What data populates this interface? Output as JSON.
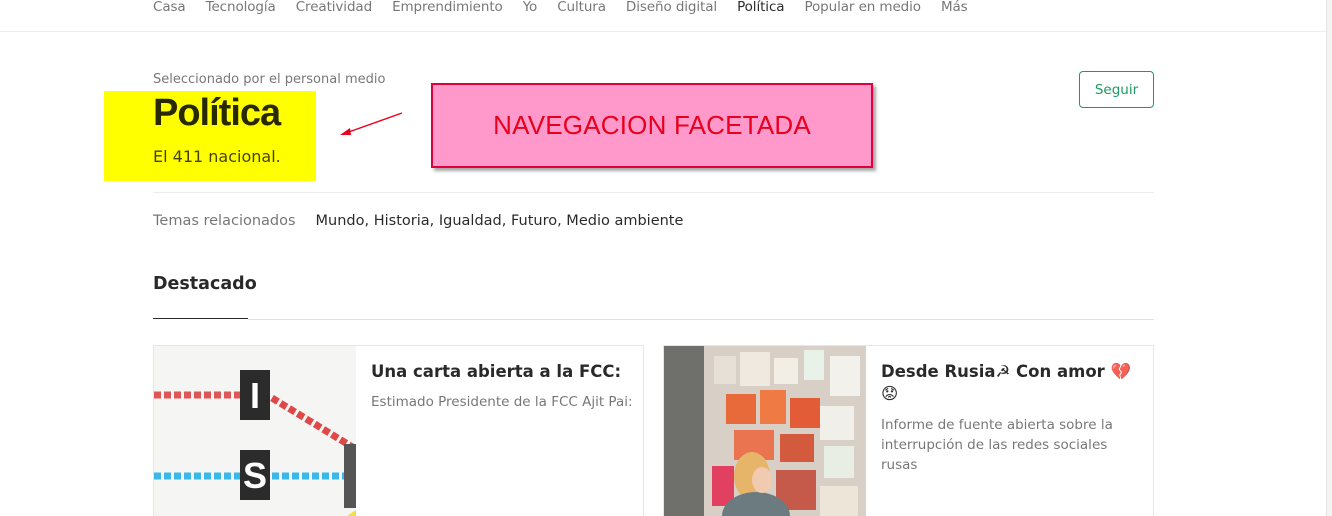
{
  "topnav": {
    "items": [
      "Casa",
      "Tecnología",
      "Creatividad",
      "Emprendimiento",
      "Yo",
      "Cultura",
      "Diseño digital",
      "Política",
      "Popular en medio",
      "Más"
    ],
    "active": "Política"
  },
  "header": {
    "curated_by": "Seleccionado por el personal medio",
    "title": "Política",
    "subtitle": "El 411 nacional.",
    "follow_label": "Seguir"
  },
  "annotation": {
    "label": "NAVEGACION FACETADA"
  },
  "related": {
    "label": "Temas relacionados",
    "topics": "Mundo, Historia, Igualdad, Futuro, Medio ambiente"
  },
  "featured": {
    "heading": "Destacado",
    "cards": [
      {
        "title": "Una carta abierta a la FCC:",
        "description": "Estimado Presidente de la FCC Ajit Pai:",
        "thumb_letters": [
          "I",
          "S"
        ]
      },
      {
        "title": "Desde Rusia☭ Con amor 💔 😟",
        "description": "Informe de fuente abierta sobre la interrupción de las redes sociales rusas"
      }
    ]
  },
  "colors": {
    "accent_green": "#1c9963",
    "highlight_yellow": "#ffff00",
    "annotation_pink": "#ff99cc",
    "annotation_red": "#e8001c"
  }
}
